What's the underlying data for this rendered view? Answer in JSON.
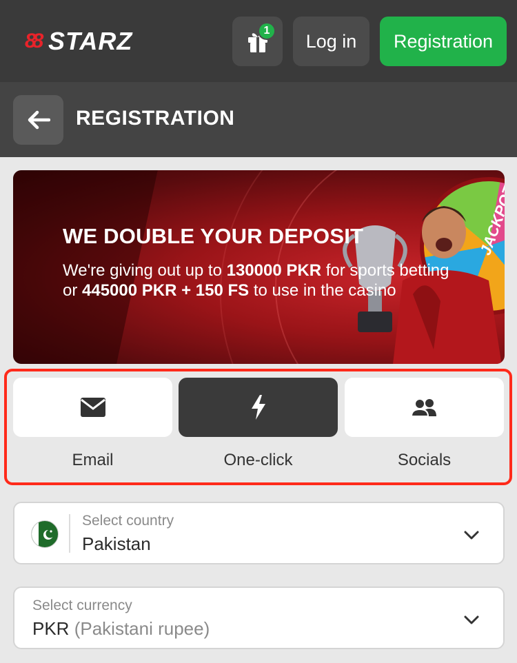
{
  "header": {
    "logo_text": "STARZ",
    "logo_mark_text": "88",
    "gift_badge_count": "1",
    "login_label": "Log in",
    "registration_label": "Registration"
  },
  "page": {
    "title": "REGISTRATION"
  },
  "banner": {
    "title": "WE DOUBLE YOUR DEPOSIT",
    "line1_prefix": "We're giving out up to ",
    "line1_amount": "130000 PKR",
    "line1_suffix": " for sports betting",
    "line2_prefix": "or ",
    "line2_amount": "445000 PKR + 150 FS",
    "line2_suffix": " to use in the casino",
    "wheel_text": "JACKPOT"
  },
  "registration_types": [
    {
      "label": "Email",
      "icon": "envelope-icon",
      "active": false
    },
    {
      "label": "One-click",
      "icon": "lightning-icon",
      "active": true
    },
    {
      "label": "Socials",
      "icon": "users-icon",
      "active": false
    }
  ],
  "country_select": {
    "label": "Select country",
    "value": "Pakistan"
  },
  "currency_select": {
    "label": "Select currency",
    "value_code": "PKR",
    "value_name": "(Pakistani rupee)"
  },
  "colors": {
    "accent_green": "#21b24a",
    "brand_red": "#e8232a",
    "highlight_red": "#ff2a1a",
    "topbar": "#3a3a3a"
  }
}
